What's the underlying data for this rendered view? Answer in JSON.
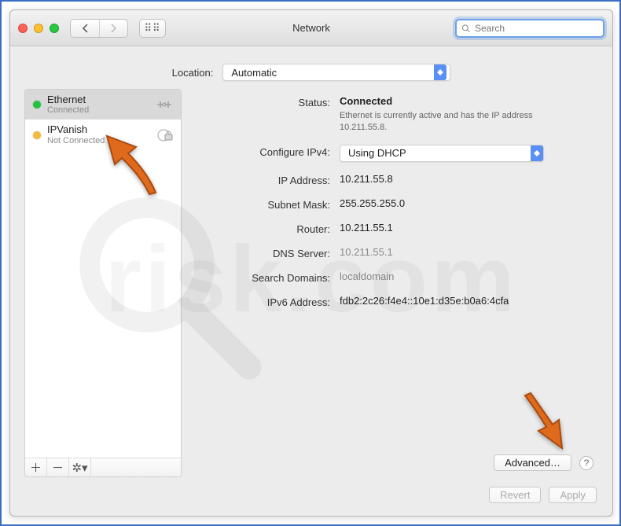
{
  "title": "Network",
  "search": {
    "placeholder": "Search"
  },
  "location": {
    "label": "Location:",
    "value": "Automatic"
  },
  "services": [
    {
      "name": "Ethernet",
      "status": "Connected",
      "state_color": "#22c33e",
      "selected": true
    },
    {
      "name": "IPVanish",
      "status": "Not Connected",
      "state_color": "#f6b93b",
      "selected": false
    }
  ],
  "details": {
    "status": {
      "label": "Status:",
      "value": "Connected",
      "description": "Ethernet is currently active and has the IP address 10.211.55.8."
    },
    "configure_ipv4": {
      "label": "Configure IPv4:",
      "value": "Using DHCP"
    },
    "ip_address": {
      "label": "IP Address:",
      "value": "10.211.55.8"
    },
    "subnet_mask": {
      "label": "Subnet Mask:",
      "value": "255.255.255.0"
    },
    "router": {
      "label": "Router:",
      "value": "10.211.55.1"
    },
    "dns_server": {
      "label": "DNS Server:",
      "value": "10.211.55.1"
    },
    "search_domains": {
      "label": "Search Domains:",
      "value": "localdomain"
    },
    "ipv6_address": {
      "label": "IPv6 Address:",
      "value": "fdb2:2c26:f4e4::10e1:d35e:b0a6:4cfa"
    }
  },
  "buttons": {
    "advanced": "Advanced…",
    "revert": "Revert",
    "apply": "Apply"
  },
  "watermark": "risk.com",
  "colors": {
    "accent": "#5a8ff5",
    "annotation_arrow": "#e06a1c"
  }
}
